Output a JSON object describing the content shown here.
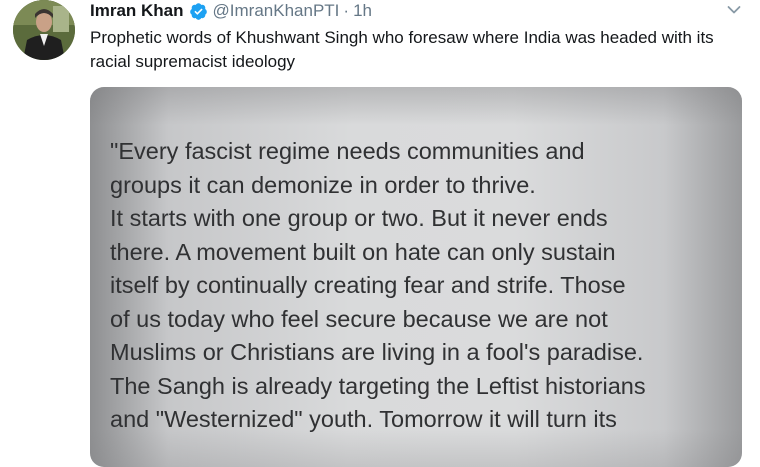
{
  "tweet": {
    "author_name": "Imran Khan",
    "handle": "@ImranKhanPTI",
    "separator": "·",
    "time": "1h",
    "text": "Prophetic words of Khushwant Singh who foresaw where India was headed with its racial supremacist ideology",
    "icons": {
      "verified": "verified-badge-icon",
      "menu": "chevron-down-icon"
    },
    "colors": {
      "verified_blue": "#1da1f2",
      "handle_gray": "#657786",
      "text": "#14171a"
    }
  },
  "media": {
    "quote_lines": [
      "\"Every fascist regime needs communities and",
      "groups it can demonize in order to thrive.",
      "It starts with one group or two. But it never ends",
      "there. A movement built on hate can only sustain",
      "itself by continually  creating fear and strife. Those",
      "of us today who feel secure because we are not",
      "Muslims or Christians are living in a fool's paradise.",
      "The Sangh is already targeting the Leftist historians",
      "and \"Westernized\" youth. Tomorrow it will turn its"
    ]
  }
}
